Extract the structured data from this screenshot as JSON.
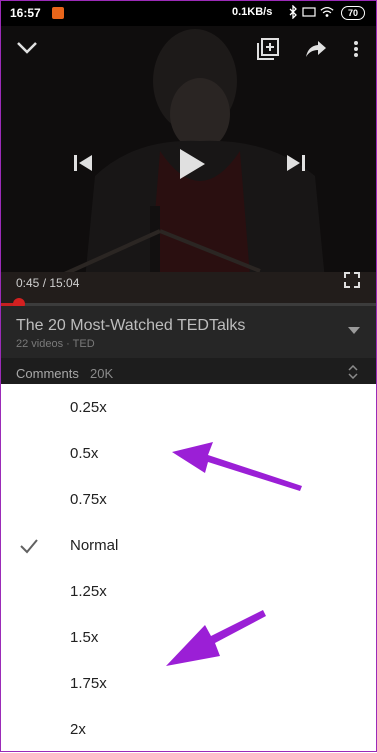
{
  "status_bar": {
    "time": "16:57",
    "network_speed": "0.1KB/s",
    "battery": "70"
  },
  "player": {
    "time_display": "0:45 / 15:04",
    "progress_fraction": 0.05
  },
  "playlist": {
    "title": "The 20 Most-Watched TEDTalks",
    "subtitle": "22 videos · TED"
  },
  "comments": {
    "label": "Comments",
    "count": "20K"
  },
  "speed_menu": {
    "selected": "Normal",
    "options": [
      "0.25x",
      "0.5x",
      "0.75x",
      "Normal",
      "1.25x",
      "1.5x",
      "1.75x",
      "2x"
    ]
  },
  "colors": {
    "annotation_arrow": "#9b1fd6",
    "progress": "#c62020"
  }
}
